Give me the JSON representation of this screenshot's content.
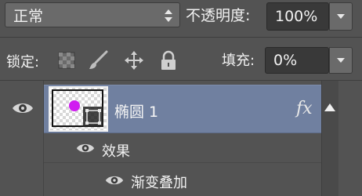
{
  "toolbar": {
    "blend_mode": "正常",
    "opacity_label": "不透明度:",
    "opacity_value": "100%",
    "lock_label": "锁定:",
    "lock_icons": [
      "lock-transparent-pixels-icon",
      "lock-image-pixels-icon",
      "lock-position-icon",
      "lock-all-icon"
    ],
    "fill_label": "填充:",
    "fill_value": "0%"
  },
  "layers": {
    "layer": {
      "name": "椭圆 1",
      "fx_label": "fx",
      "visible": true,
      "thumbnail_dot_color": "#d01cf0"
    },
    "effects_label": "效果",
    "effects": [
      {
        "name": "渐变叠加",
        "visible": true
      }
    ]
  },
  "colors": {
    "panel_bg": "#535353",
    "selected_layer_bg": "#7080a0",
    "field_bg": "#393939"
  }
}
